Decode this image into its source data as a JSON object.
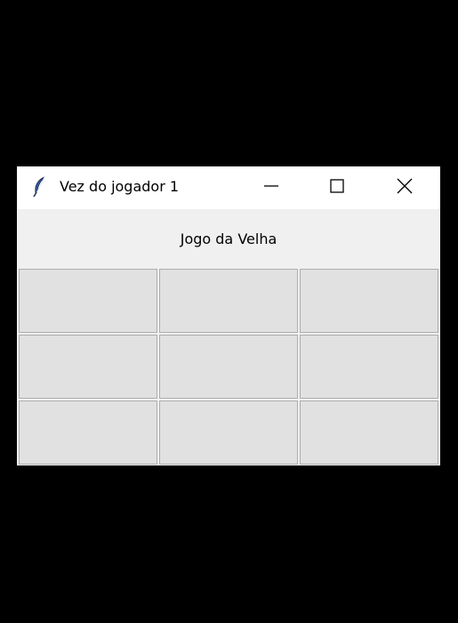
{
  "window": {
    "title": "Vez do jogador 1",
    "icon": "feather-icon",
    "controls": [
      "minimize-icon",
      "maximize-icon",
      "close-icon"
    ]
  },
  "game": {
    "heading": "Jogo da Velha",
    "board": [
      [
        "",
        "",
        ""
      ],
      [
        "",
        "",
        ""
      ],
      [
        "",
        "",
        ""
      ]
    ]
  }
}
